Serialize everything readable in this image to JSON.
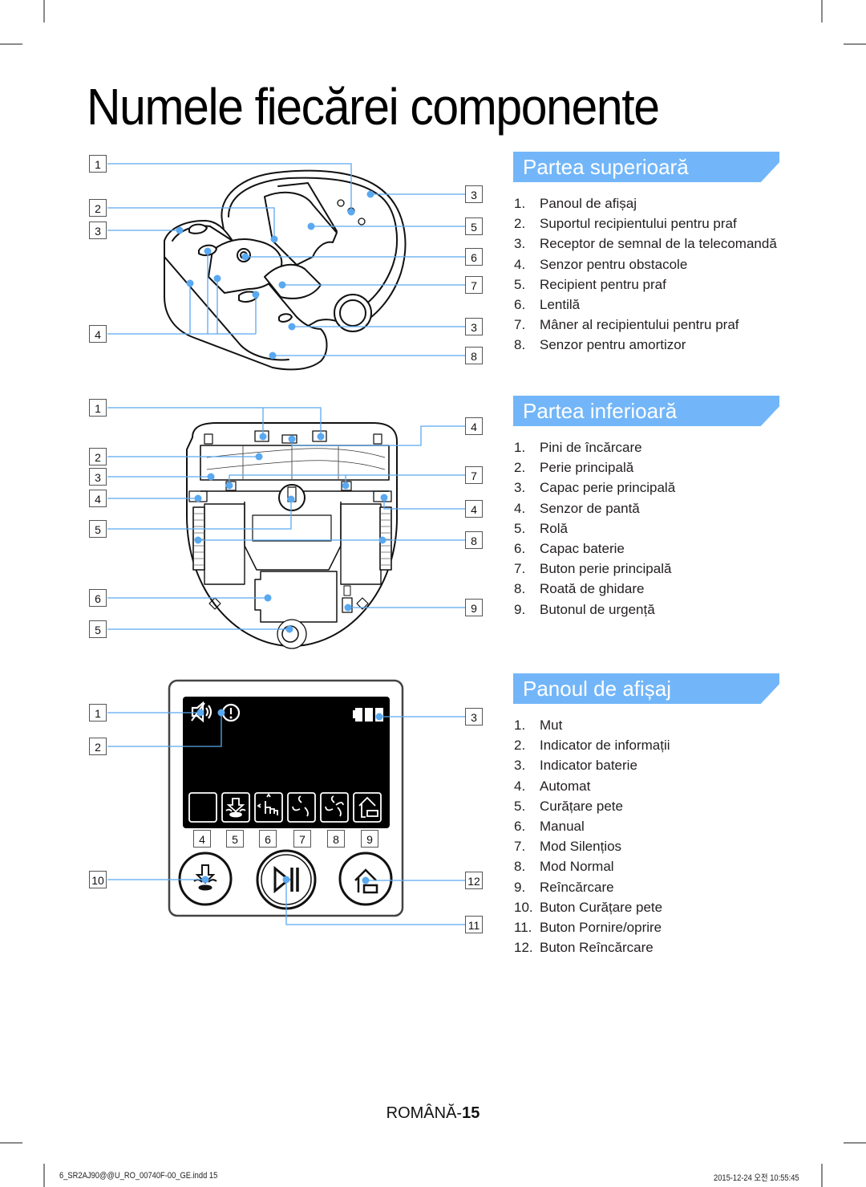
{
  "page": {
    "title": "Numele fiecărei componente",
    "page_label": "ROMÂNĂ-",
    "page_number": "15",
    "footer_file": "6_SR2AJ90@@U_RO_00740F-00_GE.indd   15",
    "footer_timestamp": "2015-12-24   오전 10:55:45"
  },
  "colors": {
    "accent": "#72b6f9",
    "callout_line": "#5aa9f0",
    "text": "#231f20"
  },
  "sections": [
    {
      "id": "top",
      "heading": "Partea superioară",
      "items": [
        {
          "num": "1.",
          "label": "Panoul de afișaj"
        },
        {
          "num": "2.",
          "label": "Suportul recipientului pentru praf"
        },
        {
          "num": "3.",
          "label": "Receptor de semnal de la telecomandă"
        },
        {
          "num": "4.",
          "label": "Senzor pentru obstacole"
        },
        {
          "num": "5.",
          "label": "Recipient pentru praf"
        },
        {
          "num": "6.",
          "label": "Lentilă"
        },
        {
          "num": "7.",
          "label": "Mâner al recipientului pentru praf"
        },
        {
          "num": "8.",
          "label": "Senzor pentru amortizor"
        }
      ]
    },
    {
      "id": "bottom",
      "heading": "Partea inferioară",
      "items": [
        {
          "num": "1.",
          "label": "Pini de încărcare"
        },
        {
          "num": "2.",
          "label": "Perie principală"
        },
        {
          "num": "3.",
          "label": "Capac perie principală"
        },
        {
          "num": "4.",
          "label": "Senzor de pantă"
        },
        {
          "num": "5.",
          "label": "Rolă"
        },
        {
          "num": "6.",
          "label": "Capac baterie"
        },
        {
          "num": "7.",
          "label": "Buton perie principală"
        },
        {
          "num": "8.",
          "label": "Roată de ghidare"
        },
        {
          "num": "9.",
          "label": "Butonul de urgență"
        }
      ]
    },
    {
      "id": "display",
      "heading": "Panoul de afișaj",
      "items": [
        {
          "num": "1.",
          "label": "Mut"
        },
        {
          "num": "2.",
          "label": "Indicator de informații"
        },
        {
          "num": "3.",
          "label": "Indicator baterie"
        },
        {
          "num": "4.",
          "label": "Automat"
        },
        {
          "num": "5.",
          "label": "Curățare pete"
        },
        {
          "num": "6.",
          "label": "Manual"
        },
        {
          "num": "7.",
          "label": "Mod Silențios"
        },
        {
          "num": "8.",
          "label": "Mod Normal"
        },
        {
          "num": "9.",
          "label": "Reîncărcare"
        },
        {
          "num": "10.",
          "label": "Buton Curățare pete"
        },
        {
          "num": "11.",
          "label": "Buton Pornire/oprire"
        },
        {
          "num": "12.",
          "label": "Buton Reîncărcare"
        }
      ]
    }
  ],
  "callouts": {
    "top_left": [
      "1",
      "2",
      "3",
      "4"
    ],
    "top_right": [
      "3",
      "5",
      "6",
      "7",
      "3",
      "8"
    ],
    "bottom_left": [
      "1",
      "2",
      "3",
      "4",
      "5",
      "6",
      "5"
    ],
    "bottom_right": [
      "4",
      "7",
      "4",
      "8",
      "9"
    ],
    "display_left": [
      "1",
      "2",
      "10"
    ],
    "display_right": [
      "3",
      "12",
      "11"
    ],
    "display_mode_row": [
      "4",
      "5",
      "6",
      "7",
      "8",
      "9"
    ]
  },
  "icons": {
    "display_top": [
      "mute-speaker-icon",
      "info-exclamation-icon",
      "battery-icon"
    ],
    "display_modes": [
      "auto-blank-icon",
      "spot-clean-icon",
      "manual-hand-icon",
      "quiet-fan-icon",
      "normal-fan-icon",
      "recharge-home-icon"
    ],
    "display_buttons": [
      "spot-clean-button-icon",
      "play-pause-icon",
      "home-recharge-button-icon"
    ]
  }
}
